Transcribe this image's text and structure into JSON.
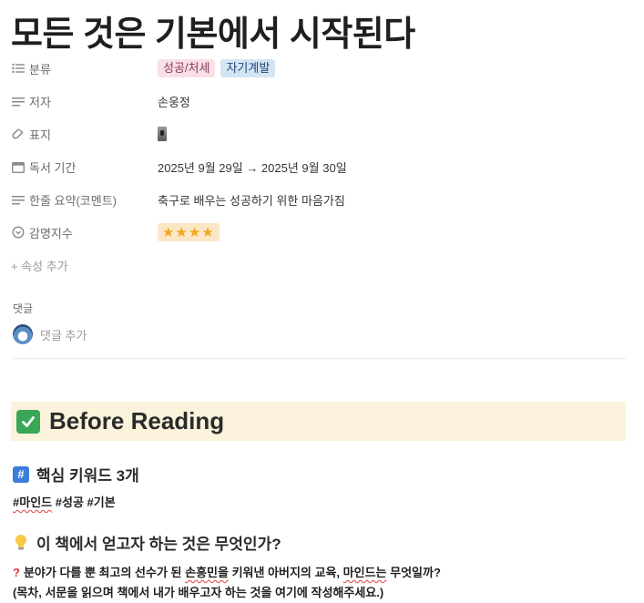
{
  "page": {
    "title": "모든 것은 기본에서 시작된다"
  },
  "properties": [
    {
      "name": "분류",
      "icon": "list-icon"
    },
    {
      "name": "저자",
      "icon": "text-icon",
      "value": "손웅정"
    },
    {
      "name": "표지",
      "icon": "link-icon"
    },
    {
      "name": "독서 기간",
      "icon": "calendar-icon",
      "value": "2025년 9월 29일 → 2025년 9월 30일"
    },
    {
      "name": "한줄 요약(코멘트)",
      "icon": "text-icon",
      "value": "축구로 배우는 성공하기 위한 마음가짐"
    },
    {
      "name": "감명지수",
      "icon": "select-icon",
      "value": "★★★★"
    }
  ],
  "tags": [
    "성공/처세",
    "자기계발"
  ],
  "add_property_label": "+ 속성 추가",
  "comments": {
    "label": "댓글",
    "add_label": "댓글 추가"
  },
  "before_reading": {
    "title": "Before Reading",
    "keywords_heading": "핵심 키워드 3개",
    "keywords": [
      "#마인드",
      "#성공",
      "#기본"
    ],
    "question_heading": "이 책에서 얻고자 하는 것은 무엇인가?",
    "question": {
      "part1": "분야가 다를 뿐 최고의 선수가 된 ",
      "name": "손흥민을",
      "part2": " 키워낸 아버지의 교육, ",
      "mind": "마인드는",
      "part3": " 무엇일까?"
    },
    "note": "(목차, 서문을 읽으며 책에서 내가 배우고자 하는 것을 여기에 작성해주세요.)"
  },
  "colors": {
    "tag_pink": "#f9dfe6",
    "tag_blue": "#d3e5f4",
    "callout_bg": "#fbf3db",
    "check_green": "#3aa757",
    "rating_bg": "#fbe7c6"
  }
}
